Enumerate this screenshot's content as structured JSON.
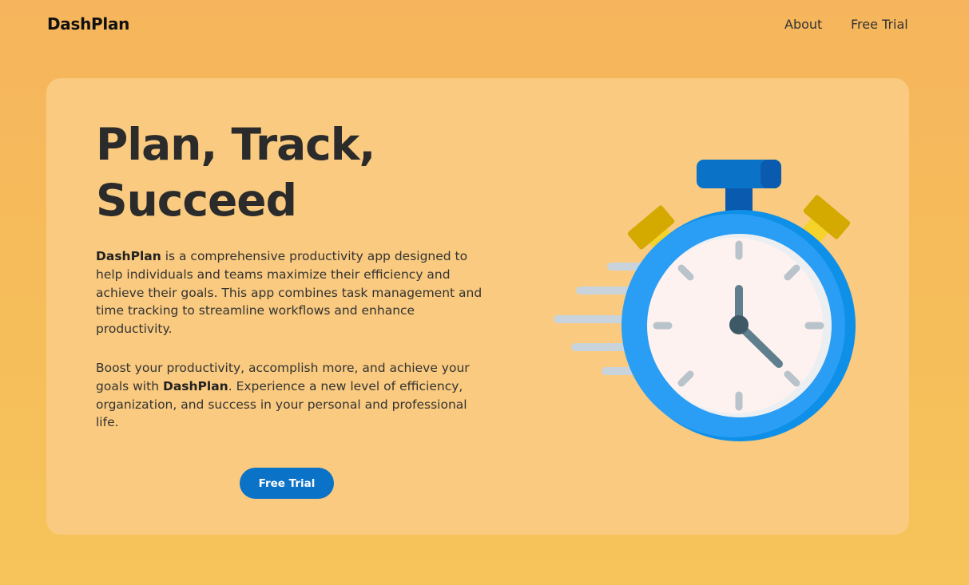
{
  "brand": {
    "name": "DashPlan"
  },
  "nav": {
    "about": "About",
    "free_trial": "Free Trial"
  },
  "hero": {
    "headline_line1": "Plan, Track,",
    "headline_line2": "Succeed",
    "para1_brand": "DashPlan",
    "para1_text": " is a comprehensive productivity app designed to help individuals and teams maximize their efficiency and achieve their goals. This app combines task management and time tracking to streamline workflows and enhance productivity.",
    "para2_text_a": "Boost your productivity, accomplish more, and achieve your goals with ",
    "para2_brand": "DashPlan",
    "para2_text_b": ". Experience a new level of efficiency, organization, and success in your personal and professional life.",
    "cta": "Free Trial"
  },
  "colors": {
    "background": "#f6b55c",
    "card": "#f9ca7f",
    "accent": "#0a72c7",
    "stopwatch_blue": "#2a9df4",
    "stopwatch_button": "#f5d32b"
  },
  "icons": {
    "illustration": "stopwatch-icon"
  }
}
